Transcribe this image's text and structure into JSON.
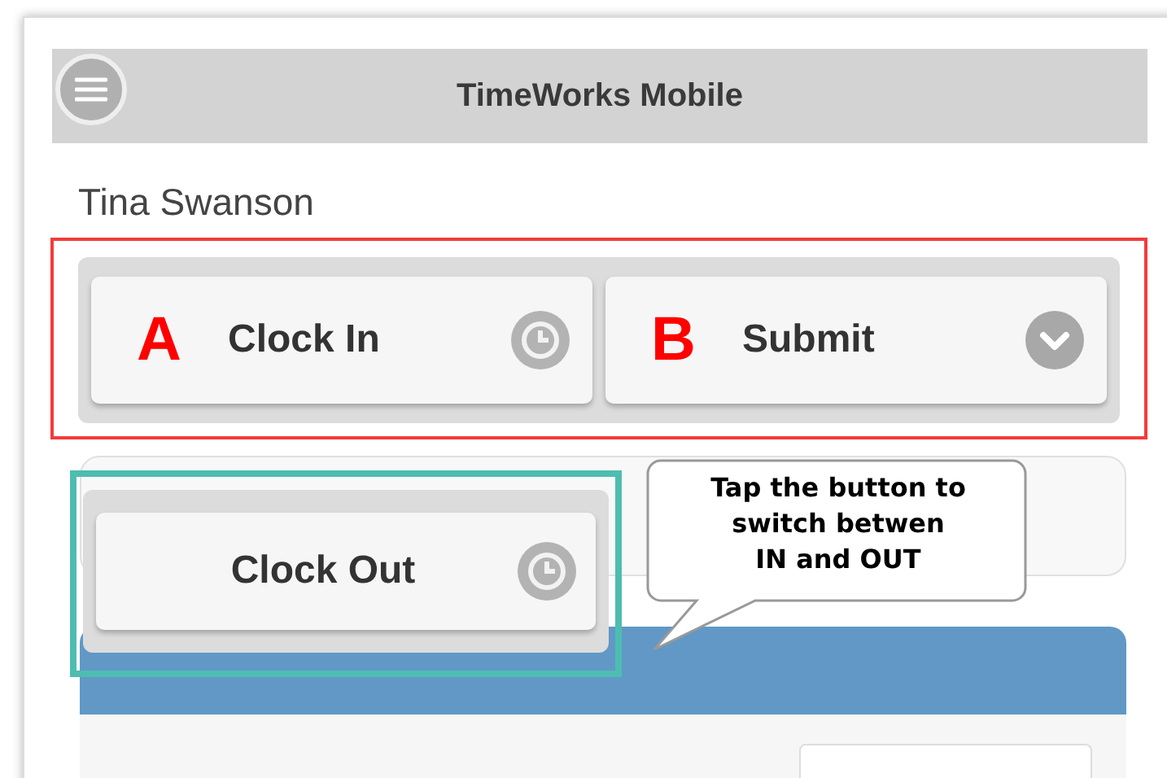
{
  "header": {
    "title": "TimeWorks Mobile"
  },
  "user_name": "Tina Swanson",
  "action_buttons": [
    {
      "marker": "A",
      "label": "Clock In",
      "kind": "clock"
    },
    {
      "marker": "B",
      "label": "Submit",
      "kind": "dropdown"
    }
  ],
  "toggle_button": {
    "label": "Clock Out"
  },
  "callout": {
    "text": "Tap the button to\nswitch betwen\nIN and OUT"
  }
}
